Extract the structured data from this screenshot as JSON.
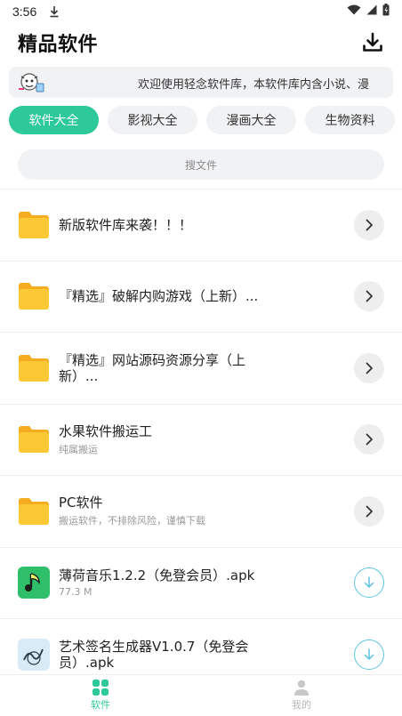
{
  "status_bar": {
    "time": "3:56"
  },
  "header": {
    "title": "精品软件",
    "download_icon": "download-icon"
  },
  "notice": {
    "icon": "cartoon-avatar-icon",
    "text": "欢迎使用轻念软件库，本软件库内含小说、漫"
  },
  "tabs": [
    {
      "label": "软件大全",
      "active": true
    },
    {
      "label": "影视大全",
      "active": false
    },
    {
      "label": "漫画大全",
      "active": false
    },
    {
      "label": "生物资料",
      "active": false
    }
  ],
  "search": {
    "placeholder": "搜文件"
  },
  "items": [
    {
      "type": "folder",
      "title": "新版软件库来袭！！！",
      "subtitle": "",
      "action": "open"
    },
    {
      "type": "folder",
      "title": "『精选』破解内购游戏（上新）...",
      "subtitle": "",
      "action": "open"
    },
    {
      "type": "folder",
      "title": "『精选』网站源码资源分享（上新）...",
      "subtitle": "",
      "action": "open"
    },
    {
      "type": "folder",
      "title": "水果软件搬运工",
      "subtitle": "纯属搬运",
      "action": "open"
    },
    {
      "type": "folder",
      "title": "PC软件",
      "subtitle": "搬运软件，不排除风险，谨慎下载",
      "action": "open"
    },
    {
      "type": "apk",
      "title": "薄荷音乐1.2.2（免登会员）.apk",
      "subtitle": "77.3 M",
      "action": "download"
    },
    {
      "type": "apk",
      "title": "艺术签名生成器V1.0.7（免登会员）.apk",
      "subtitle": "",
      "action": "download"
    }
  ],
  "bottom_nav": [
    {
      "label": "软件",
      "icon": "grid-icon",
      "active": true
    },
    {
      "label": "我的",
      "icon": "user-icon",
      "active": false
    }
  ],
  "colors": {
    "accent": "#2ec99a",
    "folder": "#fbc434",
    "download": "#5dc4e0"
  }
}
